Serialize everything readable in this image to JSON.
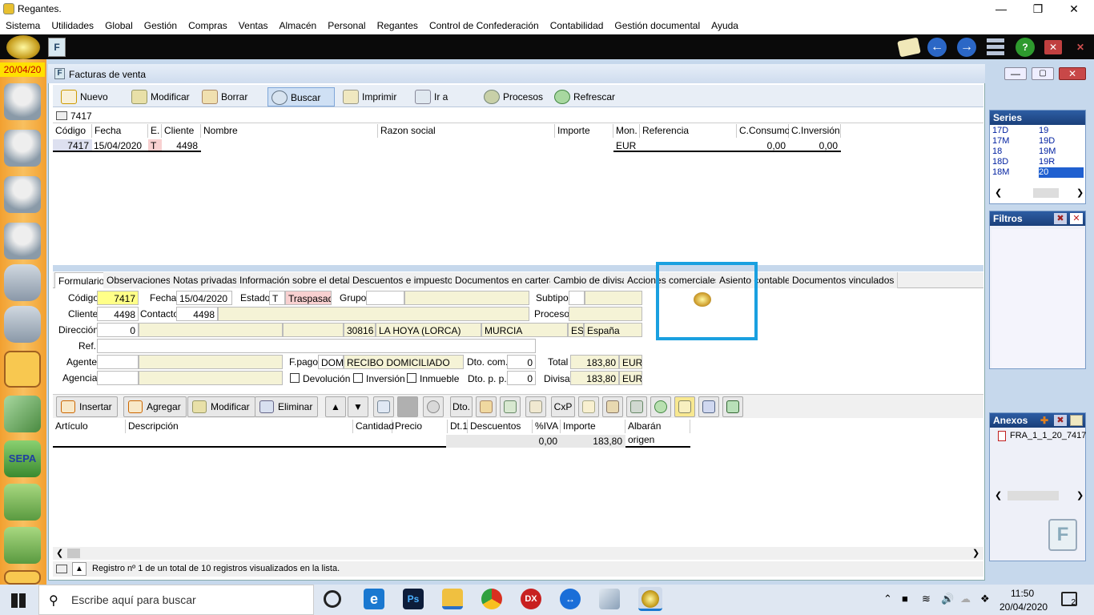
{
  "window": {
    "title": "Regantes.",
    "min": "—",
    "max": "❐",
    "close": "✕"
  },
  "menu": [
    "Sistema",
    "Utilidades",
    "Global",
    "Gestión",
    "Compras",
    "Ventas",
    "Almacén",
    "Personal",
    "Regantes",
    "Control de Confederación",
    "Contabilidad",
    "Gestión documental",
    "Ayuda"
  ],
  "sidebar": {
    "date": "20/04/20"
  },
  "form": {
    "title": "Facturas de venta",
    "toolbar": {
      "nuevo": "Nuevo",
      "modificar": "Modificar",
      "borrar": "Borrar",
      "buscar": "Buscar",
      "imprimir": "Imprimir",
      "ira": "Ir a",
      "procesos": "Procesos",
      "refrescar": "Refrescar"
    },
    "search_value": "7417",
    "grid_headers": {
      "codigo": "Código",
      "fecha": "Fecha",
      "e": "E.",
      "cliente": "Cliente",
      "nombre": "Nombre",
      "razon": "Razon social",
      "importe": "Importe",
      "mon": "Mon.",
      "referencia": "Referencia",
      "cconsumo": "C.Consumo",
      "cinversion": "C.Inversión"
    },
    "grid_row": {
      "codigo": "7417",
      "fecha": "15/04/2020",
      "e": "T",
      "cliente": "4498",
      "nombre": "",
      "razon": "",
      "importe": "",
      "mon": "EUR",
      "referencia": "",
      "cconsumo": "0,00",
      "cinversion": "0,00"
    },
    "tabs": [
      "Formulario",
      "Observaciones",
      "Notas privadas",
      "Información sobre el detalle",
      "Descuentos e impuestos",
      "Documentos en cartera",
      "Cambio de divisa",
      "Acciones comerciales",
      "Asiento contable",
      "Documentos vinculados"
    ],
    "labels": {
      "codigo": "Código",
      "fecha": "Fecha",
      "estado": "Estado",
      "grupo": "Grupo",
      "subtipo": "Subtipo",
      "cliente": "Cliente",
      "contacto": "Contacto",
      "proceso": "Proceso",
      "direccion": "Dirección",
      "ref": "Ref.",
      "agente": "Agente",
      "fpago": "F.pago",
      "dtocom": "Dto. com.",
      "total": "Total",
      "agencia": "Agencia",
      "devolucion": "Devolución",
      "inversion": "Inversión",
      "inmueble": "Inmueble",
      "dtopp": "Dto. p. p.",
      "divisa": "Divisa"
    },
    "values": {
      "codigo": "7417",
      "fecha": "15/04/2020",
      "estado_code": "T",
      "estado": "Traspasad",
      "cliente": "4498",
      "contacto": "4498",
      "direccion": "0",
      "cp": "30816",
      "poblacion": "LA HOYA (LORCA)",
      "provincia": "MURCIA",
      "pais_code": "ES",
      "pais": "España",
      "fpago_code": "DOM",
      "fpago": "RECIBO DOMICILIADO",
      "dtocom": "0",
      "total": "183,80",
      "total_cur": "EUR",
      "dtopp": "0",
      "divisa": "183,80",
      "divisa_cur": "EUR"
    },
    "buttons": {
      "insertar": "Insertar",
      "agregar": "Agregar",
      "modificar": "Modificar",
      "eliminar": "Eliminar",
      "dto": "Dto.",
      "cxp": "CxP"
    },
    "detail_headers": {
      "articulo": "Artículo",
      "descripcion": "Descripción",
      "cantidad": "Cantidad",
      "precio": "Precio",
      "dt1": "Dt.1",
      "descuentos": "Descuentos",
      "iva": "%IVA",
      "importe": "Importe",
      "albaran": "Albarán origen"
    },
    "detail_row": {
      "iva": "0,00",
      "importe": "183,80"
    },
    "status": "Registro nº 1 de un total de 10 registros visualizados en la lista."
  },
  "series": {
    "title": "Series",
    "items": [
      "17D",
      "19",
      "17M",
      "19D",
      "18",
      "19M",
      "18D",
      "19R",
      "18M",
      "20"
    ],
    "selected": "20"
  },
  "filtros": {
    "title": "Filtros"
  },
  "anexos": {
    "title": "Anexos",
    "file": "FRA_1_1_20_7417"
  },
  "taskbar": {
    "search_placeholder": "Escribe aquí para buscar",
    "time": "11:50",
    "date": "20/04/2020",
    "notif_count": "2"
  },
  "colors": {
    "accent": "#1aa0e0",
    "sidebar": "#f2a030"
  }
}
